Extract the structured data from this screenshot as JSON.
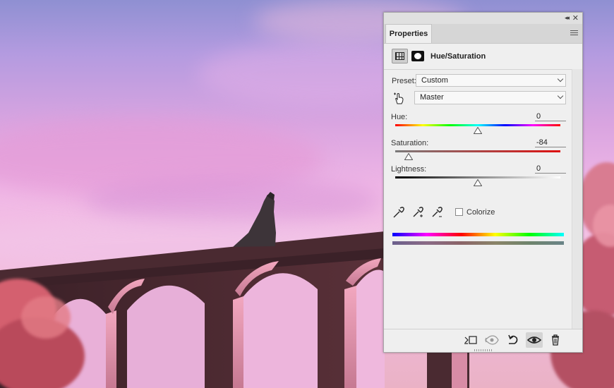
{
  "panel": {
    "tab_label": "Properties",
    "adjustment_title": "Hue/Saturation",
    "preset_label": "Preset:",
    "preset_value": "Custom",
    "range_value": "Master",
    "hue_label": "Hue:",
    "hue_value": "0",
    "saturation_label": "Saturation:",
    "saturation_value": "-84",
    "lightness_label": "Lightness:",
    "lightness_value": "0",
    "colorize_label": "Colorize",
    "colorize_checked": false
  },
  "icons": {
    "collapse": "double-chevron-left-icon",
    "close": "close-icon",
    "panel_menu": "hamburger-menu-icon",
    "adjustment": "hue-saturation-grid-icon",
    "mask": "layer-mask-icon",
    "targeted_adjustment": "hand-pointer-icon",
    "eyedroppers": [
      "eyedropper-icon",
      "eyedropper-plus-icon",
      "eyedropper-minus-icon"
    ],
    "footer": [
      "clip-to-layer-icon",
      "view-previous-state-icon",
      "reset-icon",
      "visibility-eye-icon",
      "trash-icon"
    ]
  },
  "sliders": {
    "hue": {
      "min": -180,
      "max": 180,
      "value": 0
    },
    "saturation": {
      "min": -100,
      "max": 100,
      "value": -84
    },
    "lightness": {
      "min": -100,
      "max": 100,
      "value": 0
    }
  }
}
